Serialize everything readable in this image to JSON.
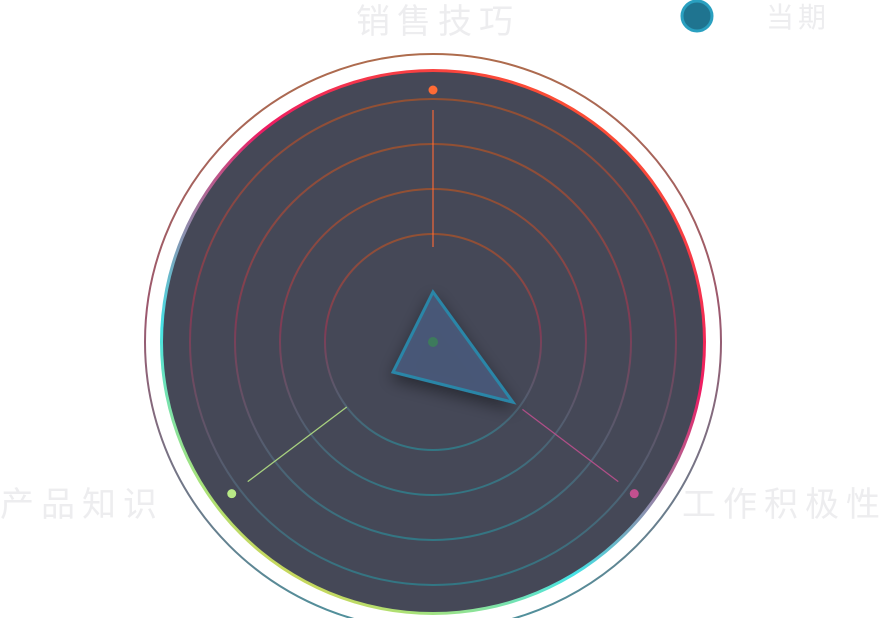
{
  "chart_data": {
    "type": "radar",
    "indicators": [
      {
        "name": "销售技巧",
        "max": 100,
        "color": "#ff6b35"
      },
      {
        "name": "工作积极性",
        "max": 100,
        "color": "#c2508f"
      },
      {
        "name": "产品知识",
        "max": 100,
        "color": "#b8e986"
      }
    ],
    "series": [
      {
        "name": "当期",
        "values": [
          20,
          40,
          20
        ],
        "color": "#2a86a8"
      }
    ],
    "legend": {
      "position": "top-right",
      "items": [
        "当期"
      ]
    },
    "rings": 5,
    "colors": {
      "background": "#454857",
      "border_gradient": [
        "#ff6b35",
        "#e8206b",
        "#45e3e6",
        "#b8e986",
        "#f5d43a"
      ]
    }
  }
}
